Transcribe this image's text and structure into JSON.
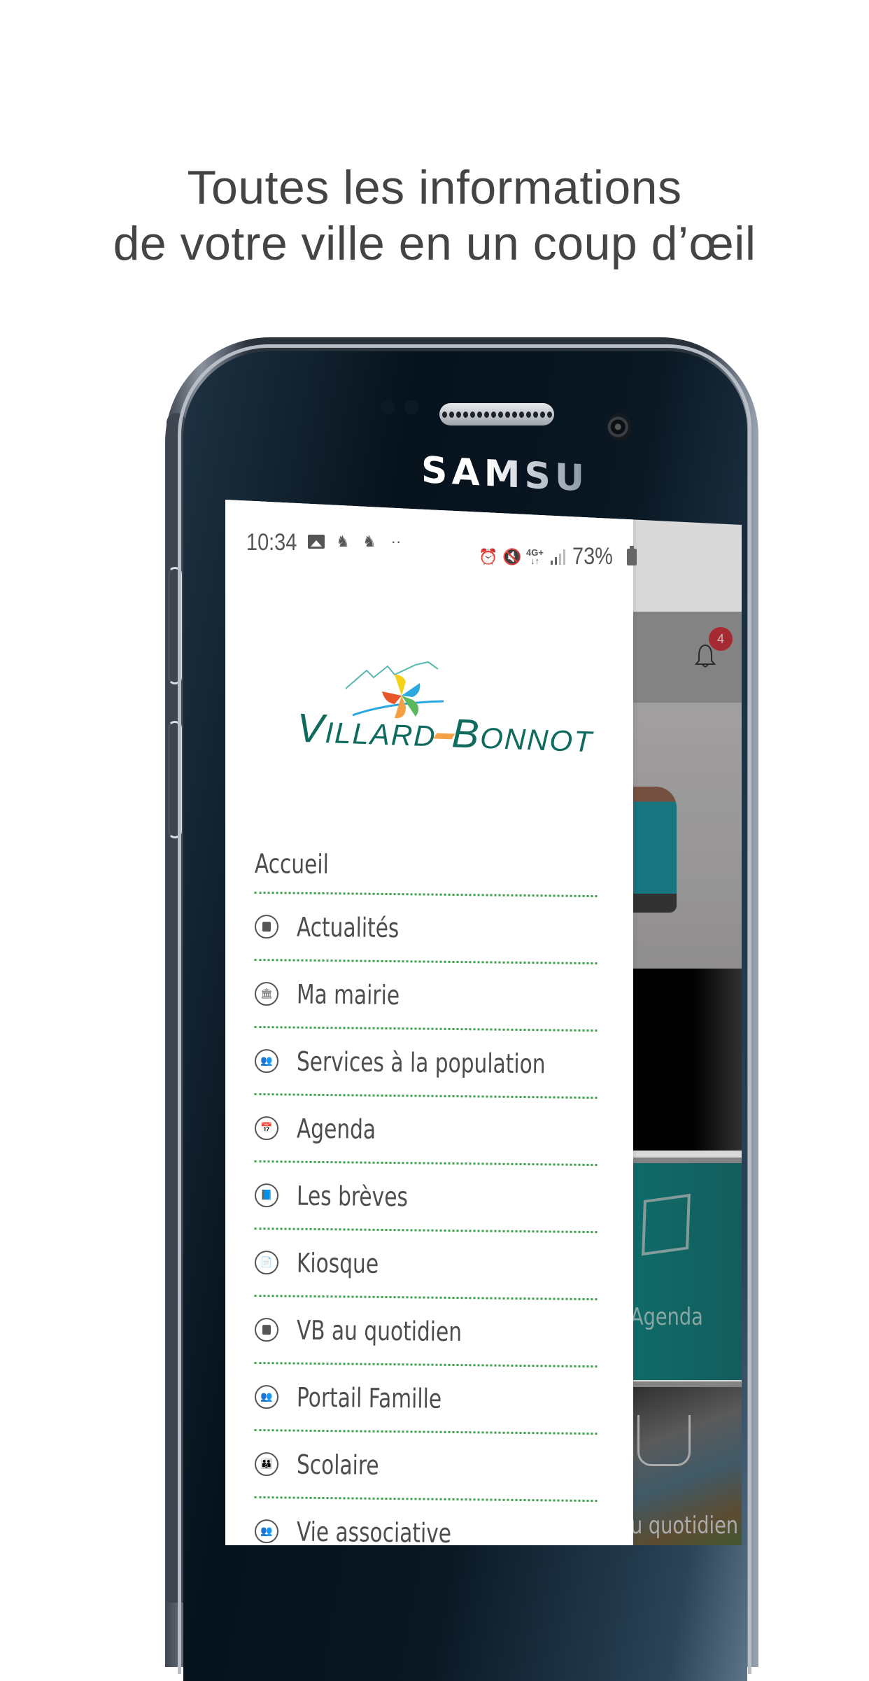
{
  "headline": {
    "line1": "Toutes les informations",
    "line2": "de votre ville en un coup d’œil"
  },
  "device": {
    "brand": "SAMSUNG"
  },
  "status_bar": {
    "time": "10:34",
    "left_icons": [
      "image-icon",
      "notification-icon",
      "notification-icon",
      "more-dots-icon"
    ],
    "more": "··",
    "right_icons": [
      "alarm-icon",
      "mute-icon",
      "network-4g-icon",
      "signal-icon",
      "battery-icon"
    ],
    "network": "4G+",
    "network_arrows": "↓↑",
    "battery": "73%"
  },
  "drawer": {
    "logo": {
      "part1_initial": "V",
      "part1_rest": "ILLARD",
      "part2_initial": "B",
      "part2_rest": "ONNOT",
      "colors": {
        "text": "#0e6b5e",
        "mountain": "#5ab9b0",
        "yellow": "#f5d21a",
        "blue": "#2aa8e0",
        "red": "#e8572a",
        "green": "#5cb85c",
        "orange": "#f4a044"
      }
    },
    "menu": [
      {
        "label": "Accueil",
        "icon": null
      },
      {
        "label": "Actualités",
        "icon": "document-icon"
      },
      {
        "label": "Ma mairie",
        "icon": "town-hall-icon"
      },
      {
        "label": "Services à la population",
        "icon": "people-icon"
      },
      {
        "label": "Agenda",
        "icon": "calendar-icon"
      },
      {
        "label": "Les brèves",
        "icon": "book-icon"
      },
      {
        "label": "Kiosque",
        "icon": "papers-icon"
      },
      {
        "label": "VB au quotidien",
        "icon": "document-icon"
      },
      {
        "label": "Portail Famille",
        "icon": "people-icon"
      },
      {
        "label": "Scolaire",
        "icon": "family-icon"
      },
      {
        "label": "Vie associative",
        "icon": "people-icon"
      }
    ],
    "divider_color": "#3aa24a"
  },
  "background_app": {
    "notification_count": "4",
    "badge_color": "#c4323a",
    "tiles": [
      {
        "label": "Agenda",
        "color": "#127e7a"
      },
      {
        "label": "u quotidien"
      }
    ]
  }
}
